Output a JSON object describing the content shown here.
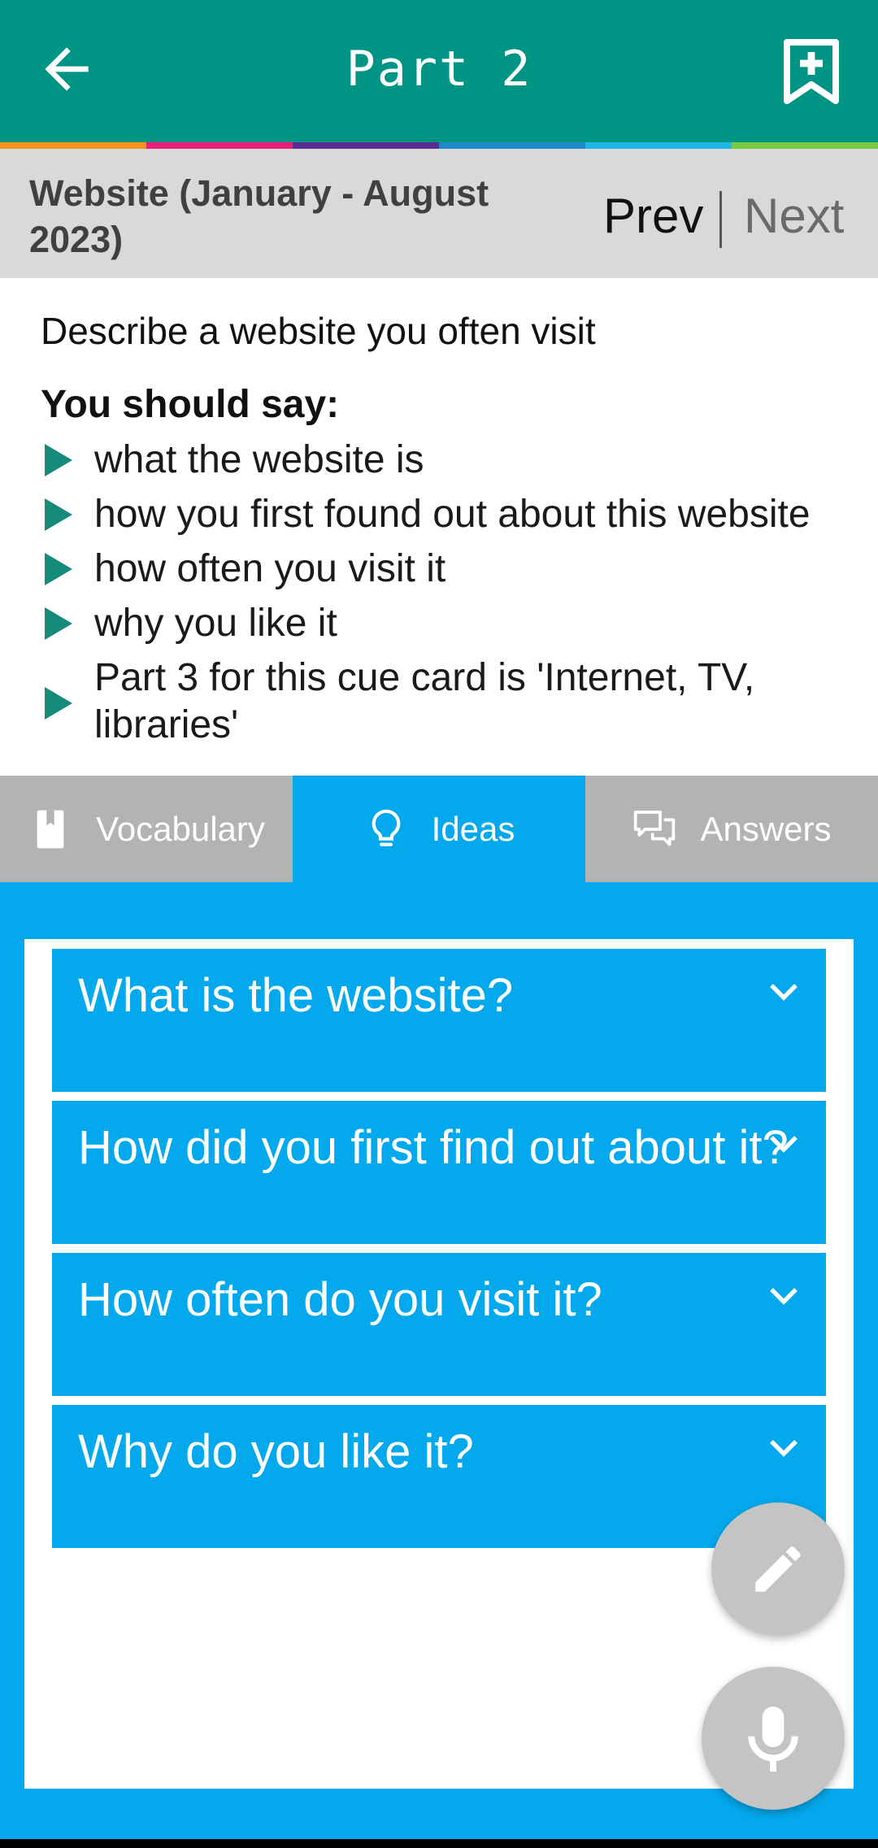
{
  "header": {
    "title": "Part 2",
    "back_icon": "arrow-left-icon",
    "bookmark_icon": "bookmark-add-icon",
    "strip_colors": [
      "#f7941d",
      "#e91e78",
      "#5c2d91",
      "#1e88c8",
      "#1fb5e6",
      "#7ac943"
    ]
  },
  "topic": {
    "title": "Website (January - August 2023)",
    "prev_label": "Prev",
    "next_label": "Next"
  },
  "cue_card": {
    "prompt": "Describe a website you often visit",
    "say_heading": "You should say:",
    "bullets": [
      "what the website is",
      "how you first found out about this website",
      "how often you visit it",
      "why you like it",
      "Part 3 for this cue card is 'Internet, TV, libraries'"
    ]
  },
  "tabs": [
    {
      "label": "Vocabulary",
      "icon": "book-icon",
      "active": false
    },
    {
      "label": "Ideas",
      "icon": "lightbulb-icon",
      "active": true
    },
    {
      "label": "Answers",
      "icon": "chat-bubbles-icon",
      "active": false
    }
  ],
  "ideas": [
    "What is the website?",
    "How did you first find out about it?",
    "How often do you visit it?",
    "Why do you like it?"
  ],
  "fabs": {
    "edit_icon": "pencil-icon",
    "mic_icon": "microphone-icon"
  },
  "colors": {
    "header": "#009485",
    "accent_blue": "#04a8ec",
    "bullet_green": "#168a7b",
    "topic_bar": "#d9d9d9"
  }
}
